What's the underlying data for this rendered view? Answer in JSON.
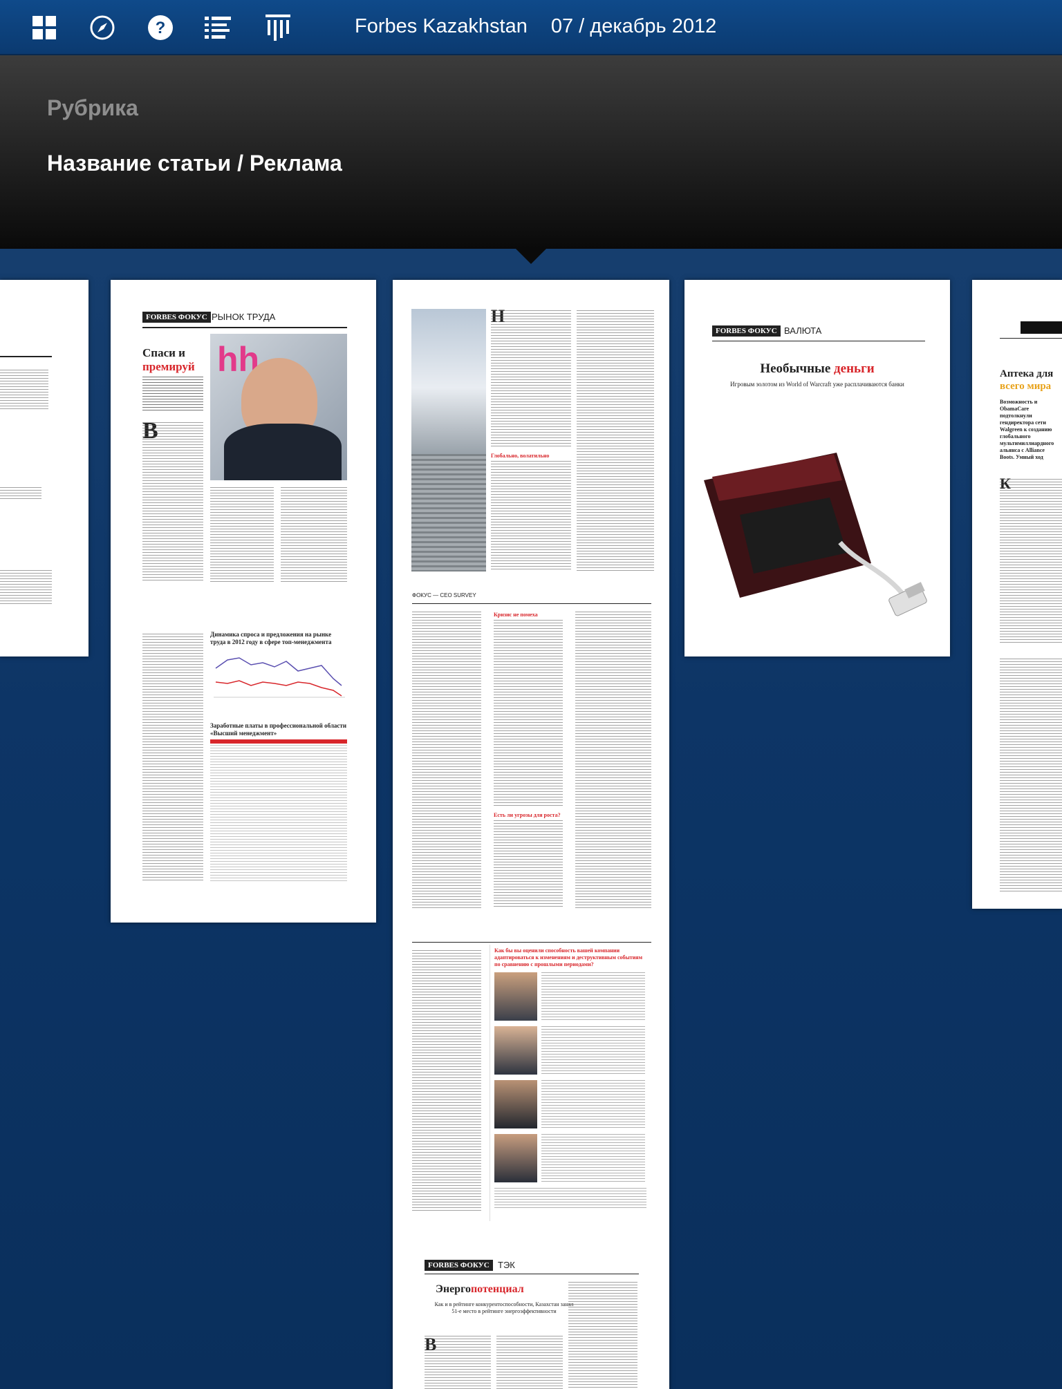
{
  "toolbar": {
    "icons": [
      "grid-icon",
      "compass-icon",
      "help-icon",
      "list-icon",
      "columns-icon"
    ],
    "magazine": "Forbes Kazakhstan",
    "issue": "07 / декабрь 2012"
  },
  "header": {
    "rubric": "Рубрика",
    "article_title": "Название статьи / Реклама"
  },
  "pages": {
    "labor": {
      "brand": "FORBES ФОКУС",
      "rubric": "РЫНОК ТРУДА",
      "title_line1": "Спаси и",
      "title_line2": "премируй",
      "chart_title": "Динамика спроса и предложения на рынке труда в 2012 году в сфере топ-менеджмента",
      "table_title": "Заработные платы в профессиональной области «Высший менеджмент»"
    },
    "center": {
      "section": "ФОКУС — CEO SURVEY",
      "sub1": "Глобально, волатильно",
      "sub2": "Кризис не помеха",
      "sub3": "Есть ли угрозы для роста?",
      "box_title": "Как бы вы оценили способность вашей компании адаптироваться к изменениям и деструктивным событиям по сравнению с прошлыми периодами?",
      "brand": "FORBES ФОКУС",
      "rubric": "ТЭК",
      "title_a": "Энерго",
      "title_b": "потенциал",
      "deck": "Как и в рейтинге конкурентоспособности, Казахстан занял 51-е место в рейтинге энергоэффективности"
    },
    "currency": {
      "brand": "FORBES ФОКУС",
      "rubric": "ВАЛЮТА",
      "title_a": "Необычные ",
      "title_b": "деньги",
      "deck": "Игровым золотом из World of Warcraft уже расплачиваются банки"
    },
    "pharmacy": {
      "title_a": "Аптека для",
      "title_b": "всего мира",
      "deck": "Возможность и ObamaCare подтолкнули гендиректора сети Walgreen к созданию глобального мультимиллиардного альянса с Alliance Boots. Умный ход"
    }
  }
}
